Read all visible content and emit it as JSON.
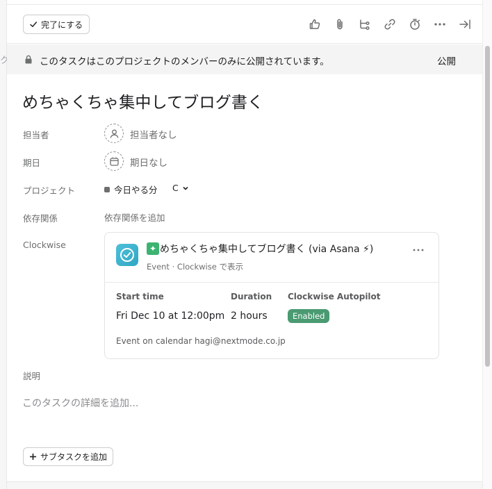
{
  "left_gutter": {
    "ghost_text": "ク"
  },
  "toolbar": {
    "complete_label": "完了にする",
    "icons": [
      "thumbs-up-icon",
      "paperclip-icon",
      "subtask-icon",
      "link-icon",
      "timer-icon",
      "more-icon",
      "close-pane-icon"
    ]
  },
  "banner": {
    "text": "このタスクはこのプロジェクトのメンバーのみに公開されています。",
    "action": "公開"
  },
  "task": {
    "title": "めちゃくちゃ集中してブログ書く"
  },
  "fields": {
    "assignee": {
      "label": "担当者",
      "value": "担当者なし"
    },
    "due_date": {
      "label": "期日",
      "value": "期日なし"
    },
    "project": {
      "label": "プロジェクト",
      "name": "今日やる分",
      "section": "C"
    },
    "dependencies": {
      "label": "依存関係",
      "action": "依存関係を追加"
    },
    "clockwise": {
      "label": "Clockwise"
    }
  },
  "clockwise_card": {
    "sparkle": "✦",
    "title": "めちゃくちゃ集中してブログ書く (via Asana ⚡︎)",
    "subtitle": "Event · Clockwise で表示",
    "start_label": "Start time",
    "start_value": "Fri Dec 10 at 12:00pm",
    "duration_label": "Duration",
    "duration_value": "2 hours",
    "autopilot_label": "Clockwise Autopilot",
    "autopilot_value": "Enabled",
    "calendar_text": "Event on calendar hagi@nextmode.co.jp",
    "colors": {
      "logo": "#2ea7c4",
      "badge": "#4a9a72",
      "sparkle": "#3cb371"
    }
  },
  "description": {
    "label": "説明",
    "placeholder": "このタスクの詳細を追加..."
  },
  "subtask": {
    "label": "サブタスクを追加"
  }
}
